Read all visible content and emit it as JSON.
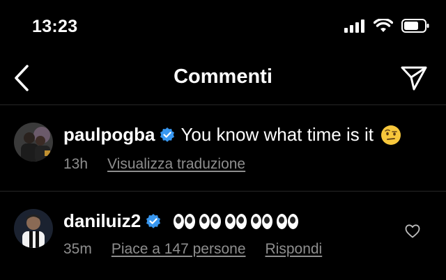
{
  "status_bar": {
    "time": "13:23"
  },
  "nav": {
    "title": "Commenti"
  },
  "comments": [
    {
      "username": "paulpogba",
      "text": "You know what time is it",
      "time": "13h",
      "translate_label": "Visualizza traduzione"
    },
    {
      "username": "daniluiz2",
      "text_emoji": "eyes x5",
      "time": "35m",
      "likes_label": "Piace a 147 persone",
      "reply_label": "Rispondi"
    }
  ],
  "colors": {
    "background": "#000000",
    "verified": "#3897f0",
    "secondary_text": "#8e8e8e",
    "divider": "#262626"
  }
}
